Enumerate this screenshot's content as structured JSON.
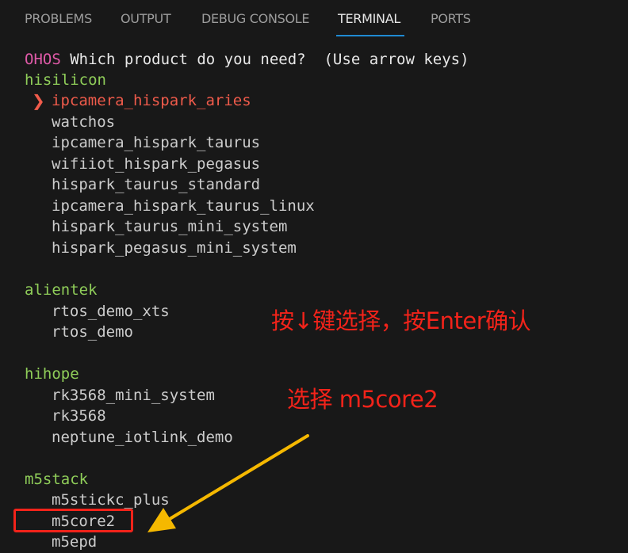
{
  "tabs": [
    {
      "label": "PROBLEMS",
      "active": false
    },
    {
      "label": "OUTPUT",
      "active": false
    },
    {
      "label": "DEBUG CONSOLE",
      "active": false
    },
    {
      "label": "TERMINAL",
      "active": true
    },
    {
      "label": "PORTS",
      "active": false
    }
  ],
  "terminal": {
    "prompt_prefix": "OHOS",
    "prompt_question": " Which product do you need?  (Use arrow keys)",
    "pointer_glyph": "❯",
    "groups": [
      {
        "name": "hisilicon",
        "items": [
          "ipcamera_hispark_aries",
          "watchos",
          "ipcamera_hispark_taurus",
          "wifiiot_hispark_pegasus",
          "hispark_taurus_standard",
          "ipcamera_hispark_taurus_linux",
          "hispark_taurus_mini_system",
          "hispark_pegasus_mini_system"
        ]
      },
      {
        "name": "alientek",
        "items": [
          "rtos_demo_xts",
          "rtos_demo"
        ]
      },
      {
        "name": "hihope",
        "items": [
          "rk3568_mini_system",
          "rk3568",
          "neptune_iotlink_demo"
        ]
      },
      {
        "name": "m5stack",
        "items": [
          "m5stickc_plus",
          "m5core2",
          "m5epd"
        ]
      }
    ],
    "selected_item": "ipcamera_hispark_aries"
  },
  "annotations": {
    "instruction": "按↓键选择，按Enter确认",
    "choose_target": "选择 m5core2",
    "highlight_target": "m5core2",
    "accent_color": "#f2231a",
    "arrow_color": "#f5b800"
  },
  "colors": {
    "background": "#181818",
    "prompt_prefix": "#e05aa8",
    "group_heading": "#8fcd59",
    "selected_item": "#f05b4b",
    "tab_active_underline": "#1f8ad2"
  }
}
